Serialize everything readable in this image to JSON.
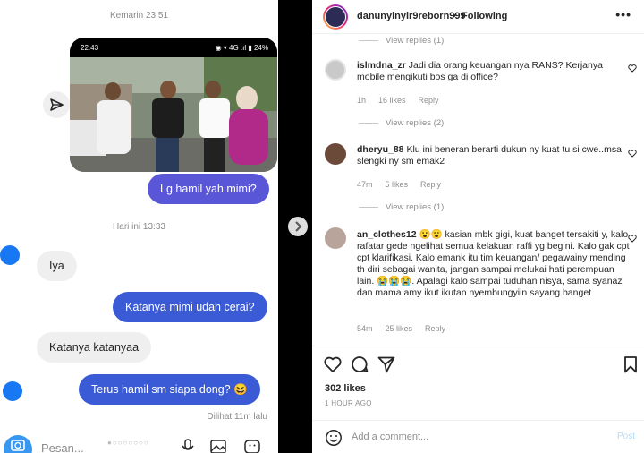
{
  "chat": {
    "timestamp_1": "Kemarin 23:51",
    "photo_status_time": "22.43",
    "photo_status_right": "◉ ▾ 4G .ıl ▮ 24%",
    "msg_out_1": "Lg hamil yah mimi?",
    "timestamp_2": "Hari ini 13:33",
    "msg_in_1": "Iya",
    "msg_out_2": "Katanya mimi udah cerai?",
    "msg_in_2": "Katanya katanyaa",
    "msg_out_3": "Terus hamil sm siapa dong? 😆",
    "seen": "Dilihat 11m lalu",
    "composer_placeholder": "Pesan...",
    "icons": [
      "send-icon",
      "camera-icon",
      "microphone-icon",
      "gallery-icon",
      "sticker-icon"
    ]
  },
  "post": {
    "username": "danunyinyir9reborn999",
    "dot": "•",
    "follow_status": "Following",
    "more": "•••",
    "comments": [
      {
        "user": "islmdna_zr",
        "text": "Jadi dia orang keuangan nya RANS? Kerjanya mobile mengikuti bos ga di office?",
        "time": "1h",
        "likes": "16 likes",
        "reply": "Reply",
        "view_replies": "View replies (2)"
      },
      {
        "user": "dheryu_88",
        "text": "Klu ini beneran berarti dukun ny kuat tu si cwe..msa slengki ny sm emak2",
        "time": "47m",
        "likes": "5 likes",
        "reply": "Reply",
        "view_replies": "View replies (1)"
      },
      {
        "user": "an_clothes12",
        "text": "😮😮 kasian mbk gigi, kuat banget tersakiti y, kalo rafatar gede ngelihat semua kelakuan raffi yg begini. Kalo gak cpt cpt klarifikasi. Kalo emank itu tim keuangan/ pegawainy mending th diri sebagai wanita, jangan sampai melukai hati perempuan lain. 😭😭😭. Apalagi kalo sampai tuduhan nisya, sama syanaz dan mama amy ikut ikutan nyembungyiin sayang banget",
        "time": "54m",
        "likes": "25 likes",
        "reply": "Reply"
      }
    ],
    "top_view_replies": "View replies (1)",
    "likes_count": "302 likes",
    "time_ago": "1 HOUR AGO",
    "add_comment_placeholder": "Add a comment...",
    "post_button": "Post",
    "colors": {
      "accent_blue": "#3b5bd6",
      "post_disabled": "#b2dffc",
      "messenger_blue": "#1877f2"
    }
  }
}
